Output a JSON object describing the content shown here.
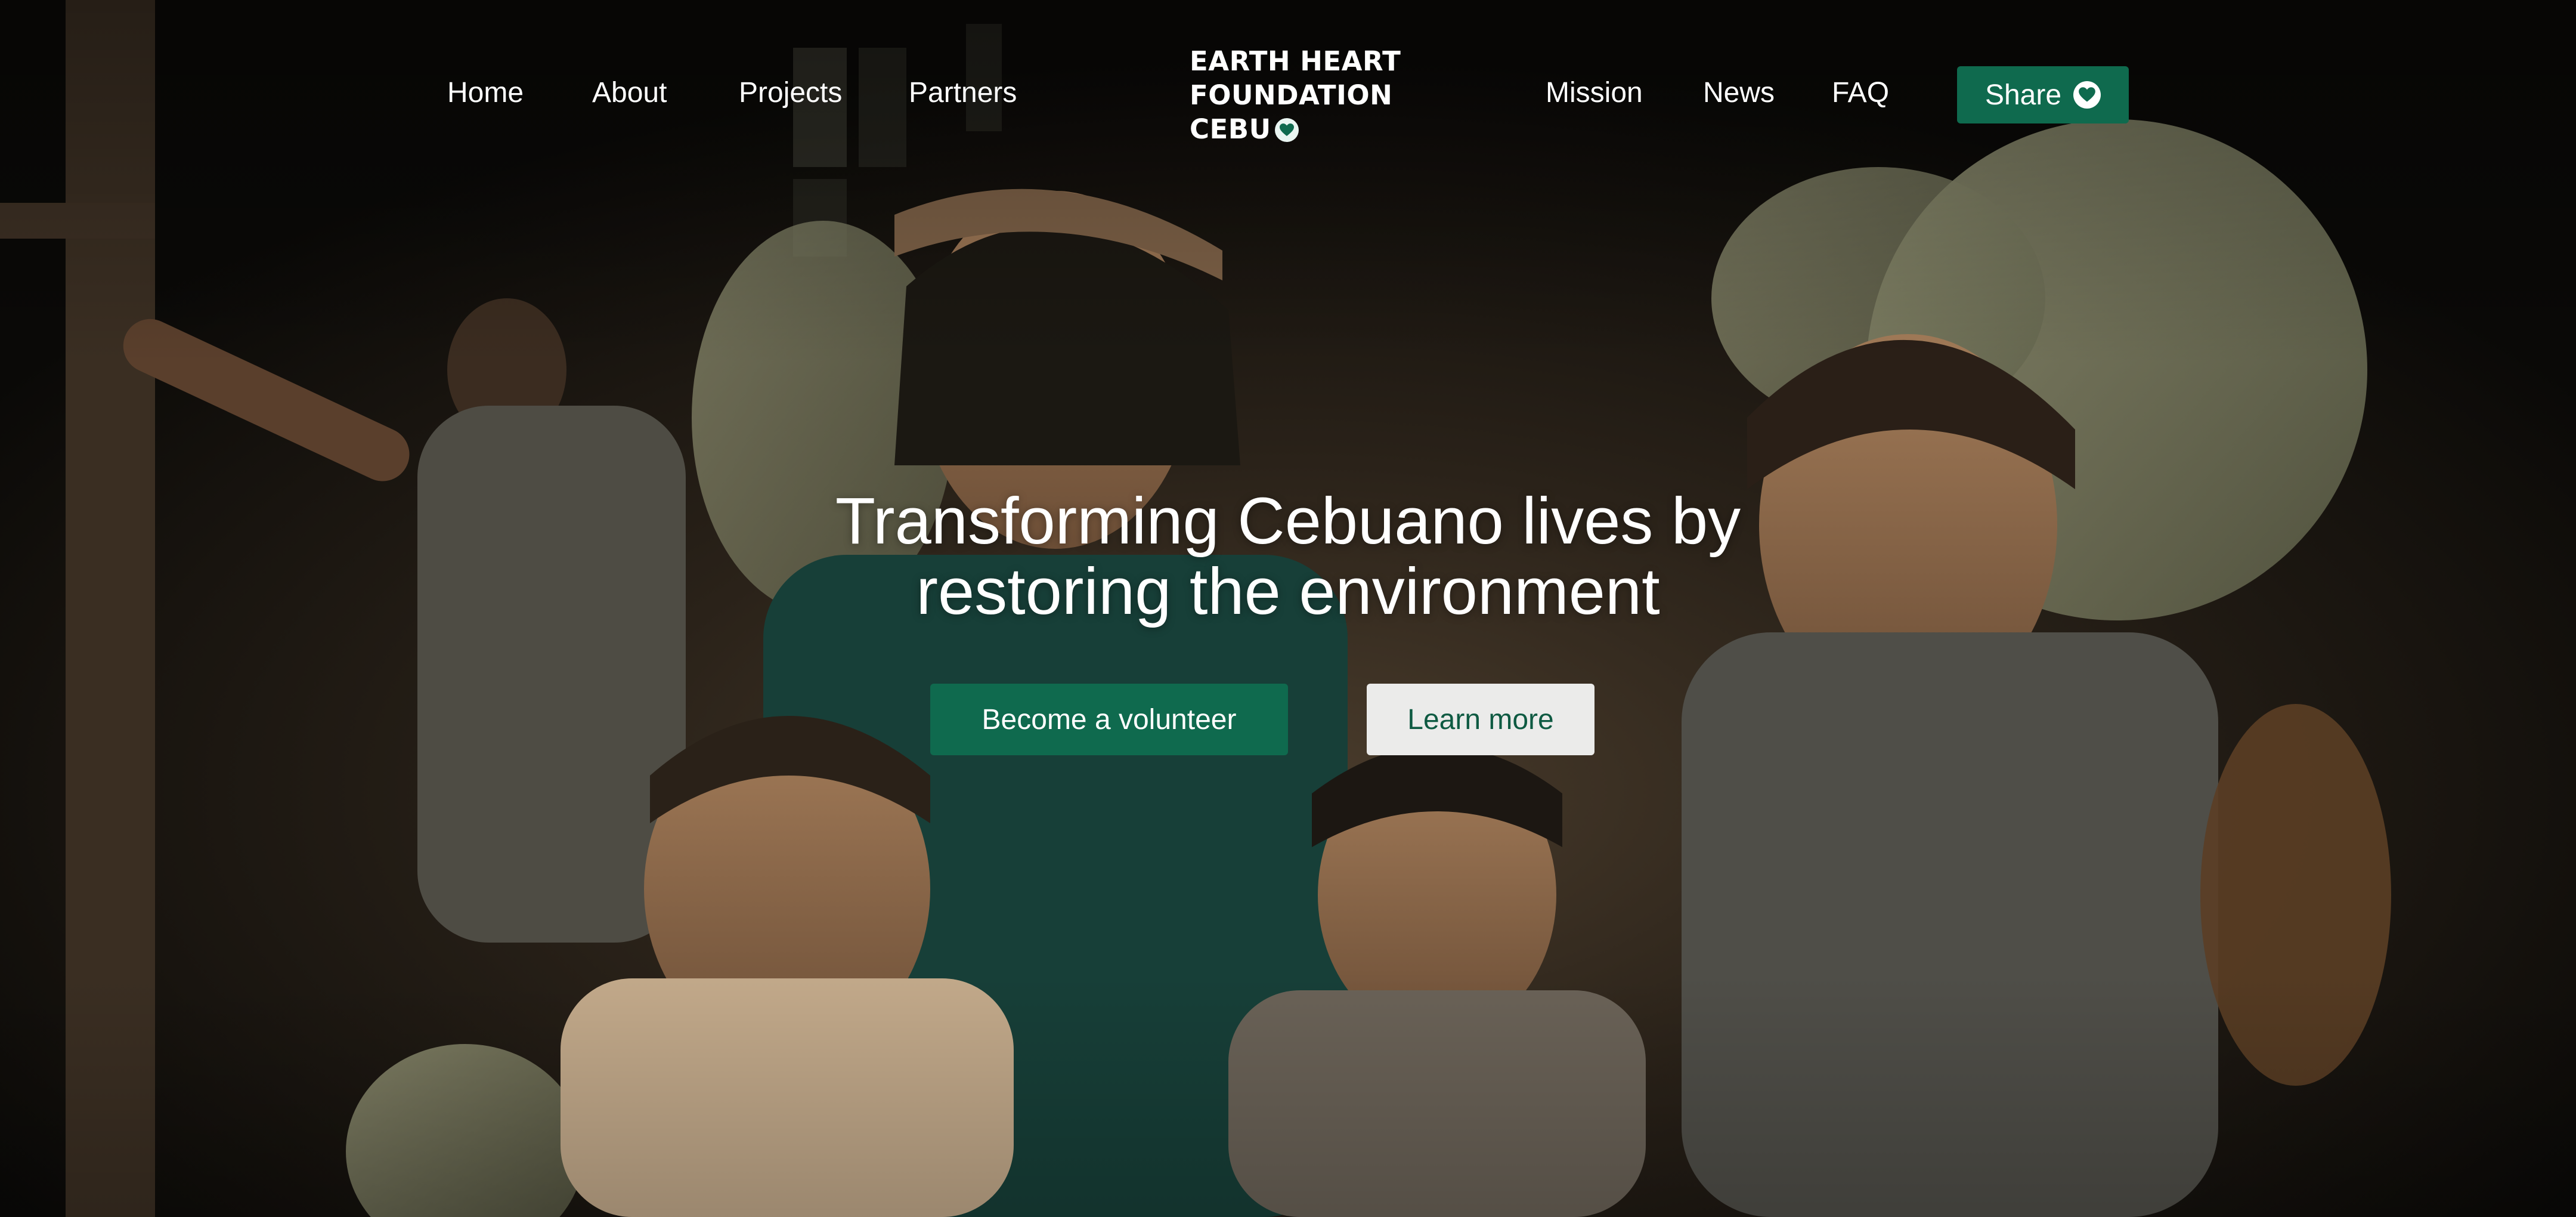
{
  "nav": {
    "left_links": [
      "Home",
      "About",
      "Projects",
      "Partners"
    ],
    "right_links": [
      "Mission",
      "News",
      "FAQ"
    ],
    "share_label": "Share",
    "share_icon": "heart-icon"
  },
  "brand": {
    "line1": "EARTH HEART",
    "line2": "FOUNDATION",
    "line3": "CEBU",
    "icon": "heart-icon"
  },
  "hero": {
    "headline_line1": "Transforming Cebuano lives by",
    "headline_line2": "restoring the environment",
    "primary_cta": "Become a volunteer",
    "secondary_cta": "Learn more"
  },
  "colors": {
    "accent_green": "#0f6a4e",
    "light_button": "#ebebea",
    "light_button_text": "#0e5a42",
    "text_white": "#ffffff"
  }
}
